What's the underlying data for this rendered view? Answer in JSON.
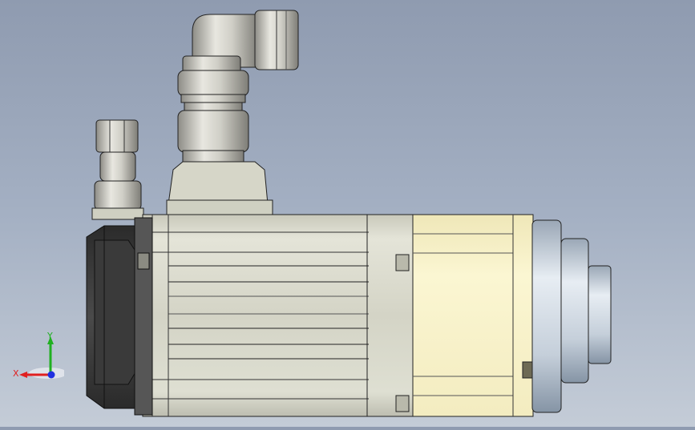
{
  "viewport": {
    "background_top": "#8f9bb0",
    "background_bottom": "#c4ccd7",
    "model": {
      "body_color": "#d6d6c8",
      "flange_color": "#f7f1c6",
      "encoder_cap_color": "#3c3c3c",
      "shaft_color": "#cfd8e2",
      "connector_color": "#c9c8c0",
      "edge_color": "#222222"
    }
  },
  "triad": {
    "x_label": "X",
    "y_label": "Y",
    "x_color": "#e02020",
    "y_color": "#20b020",
    "z_color": "#2030e0"
  }
}
